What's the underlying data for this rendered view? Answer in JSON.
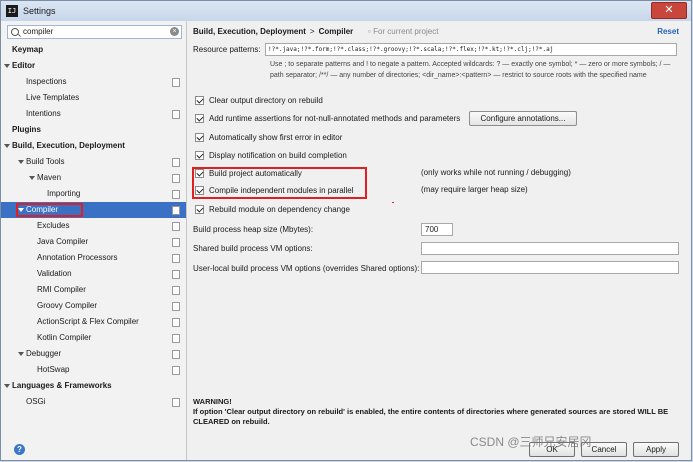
{
  "window": {
    "title": "Settings",
    "icon_text": "IJ"
  },
  "search": {
    "value": "compiler"
  },
  "tree": [
    {
      "label": "Keymap",
      "bold": true,
      "level": 0,
      "arrow": false,
      "copy": false
    },
    {
      "label": "Editor",
      "bold": true,
      "level": 0,
      "arrow": true,
      "copy": false
    },
    {
      "label": "Inspections",
      "bold": false,
      "level": 1,
      "arrow": false,
      "copy": true
    },
    {
      "label": "Live Templates",
      "bold": false,
      "level": 1,
      "arrow": false,
      "copy": false
    },
    {
      "label": "Intentions",
      "bold": false,
      "level": 1,
      "arrow": false,
      "copy": true
    },
    {
      "label": "Plugins",
      "bold": true,
      "level": 0,
      "arrow": false,
      "copy": false
    },
    {
      "label": "Build, Execution, Deployment",
      "bold": true,
      "level": 0,
      "arrow": true,
      "copy": false
    },
    {
      "label": "Build Tools",
      "bold": false,
      "level": 1,
      "arrow": true,
      "copy": true
    },
    {
      "label": "Maven",
      "bold": false,
      "level": 2,
      "arrow": true,
      "copy": true
    },
    {
      "label": "Importing",
      "bold": false,
      "level": 3,
      "arrow": false,
      "copy": true
    },
    {
      "label": "Compiler",
      "bold": false,
      "level": 1,
      "arrow": true,
      "copy": true,
      "selected": true
    },
    {
      "label": "Excludes",
      "bold": false,
      "level": 2,
      "arrow": false,
      "copy": true
    },
    {
      "label": "Java Compiler",
      "bold": false,
      "level": 2,
      "arrow": false,
      "copy": true
    },
    {
      "label": "Annotation Processors",
      "bold": false,
      "level": 2,
      "arrow": false,
      "copy": true
    },
    {
      "label": "Validation",
      "bold": false,
      "level": 2,
      "arrow": false,
      "copy": true
    },
    {
      "label": "RMI Compiler",
      "bold": false,
      "level": 2,
      "arrow": false,
      "copy": true
    },
    {
      "label": "Groovy Compiler",
      "bold": false,
      "level": 2,
      "arrow": false,
      "copy": true
    },
    {
      "label": "ActionScript & Flex Compiler",
      "bold": false,
      "level": 2,
      "arrow": false,
      "copy": true
    },
    {
      "label": "Kotlin Compiler",
      "bold": false,
      "level": 2,
      "arrow": false,
      "copy": true
    },
    {
      "label": "Debugger",
      "bold": false,
      "level": 1,
      "arrow": true,
      "copy": true
    },
    {
      "label": "HotSwap",
      "bold": false,
      "level": 2,
      "arrow": false,
      "copy": true
    },
    {
      "label": "Languages & Frameworks",
      "bold": true,
      "level": 0,
      "arrow": true,
      "copy": false
    },
    {
      "label": "OSGi",
      "bold": false,
      "level": 1,
      "arrow": false,
      "copy": true
    }
  ],
  "breadcrumb": {
    "parent": "Build, Execution, Deployment",
    "separator": ">",
    "current": "Compiler",
    "note": "For current project"
  },
  "reset_label": "Reset",
  "resource": {
    "label": "Resource patterns:",
    "value": "!?*.java;!?*.form;!?*.class;!?*.groovy;!?*.scala;!?*.flex;!?*.kt;!?*.clj;!?*.aj",
    "help": "Use ; to separate patterns and ! to negate a pattern. Accepted wildcards: ? — exactly one symbol; * — zero or more symbols; / — path separator; /**/ — any number of directories; <dir_name>:<pattern> — restrict to source roots with the specified name"
  },
  "options": [
    {
      "label": "Clear output directory on rebuild",
      "checked": true,
      "note": ""
    },
    {
      "label": "Add runtime assertions for not-null-annotated methods and parameters",
      "checked": true,
      "note": ""
    },
    {
      "label": "Automatically show first error in editor",
      "checked": true,
      "note": ""
    },
    {
      "label": "Display notification on build completion",
      "checked": true,
      "note": ""
    },
    {
      "label": "Build project automatically",
      "checked": true,
      "note": "(only works while not running / debugging)"
    },
    {
      "label": "Compile independent modules in parallel",
      "checked": true,
      "note": "(may require larger heap size)"
    },
    {
      "label": "Rebuild module on dependency change",
      "checked": true,
      "note": ""
    }
  ],
  "configure_annotations_label": "Configure annotations...",
  "fields": {
    "heap_label": "Build process heap size (Mbytes):",
    "heap_value": "700",
    "shared_label": "Shared build process VM options:",
    "shared_value": "",
    "user_label": "User-local build process VM options (overrides Shared options):",
    "user_value": ""
  },
  "warning": {
    "title": "WARNING!",
    "text": "If option 'Clear output directory on rebuild' is enabled, the entire contents of directories where generated sources are stored WILL BE CLEARED on rebuild."
  },
  "buttons": {
    "ok": "OK",
    "cancel": "Cancel",
    "apply": "Apply"
  },
  "watermark": "CSDN @三师兄安居冈",
  "colors": {
    "selection": "#3a71c4",
    "highlight_box": "#e02020",
    "link": "#2663b5"
  }
}
